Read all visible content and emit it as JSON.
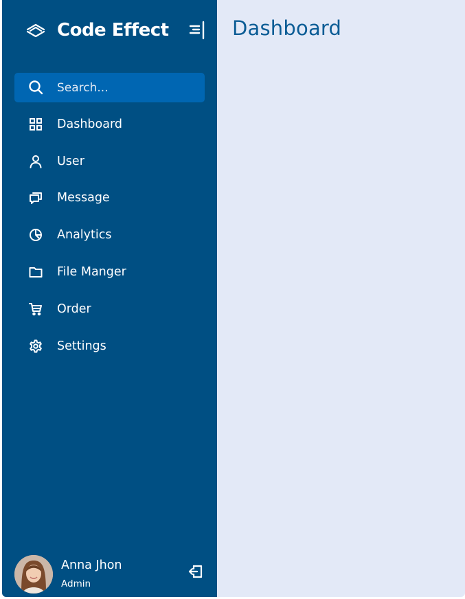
{
  "brand": {
    "name": "Code Effect",
    "logo_icon": "layers-wave-icon"
  },
  "toggle_icon": "menu-lines-icon",
  "search": {
    "placeholder": "Search...",
    "value": "",
    "icon": "search-icon"
  },
  "nav": {
    "items": [
      {
        "label": "Dashboard",
        "icon": "grid-icon"
      },
      {
        "label": "User",
        "icon": "user-icon"
      },
      {
        "label": "Message",
        "icon": "chat-icon"
      },
      {
        "label": "Analytics",
        "icon": "pie-chart-icon"
      },
      {
        "label": "File Manger",
        "icon": "folder-icon"
      },
      {
        "label": "Order",
        "icon": "cart-icon"
      },
      {
        "label": "Settings",
        "icon": "gear-icon"
      }
    ]
  },
  "profile": {
    "name": "Anna Jhon",
    "role": "Admin",
    "logout_icon": "logout-icon"
  },
  "main": {
    "title": "Dashboard"
  },
  "colors": {
    "sidebar_bg": "#004f83",
    "search_bg": "#0066b2",
    "main_bg": "#e3e9f7",
    "title": "#0b5c95"
  }
}
